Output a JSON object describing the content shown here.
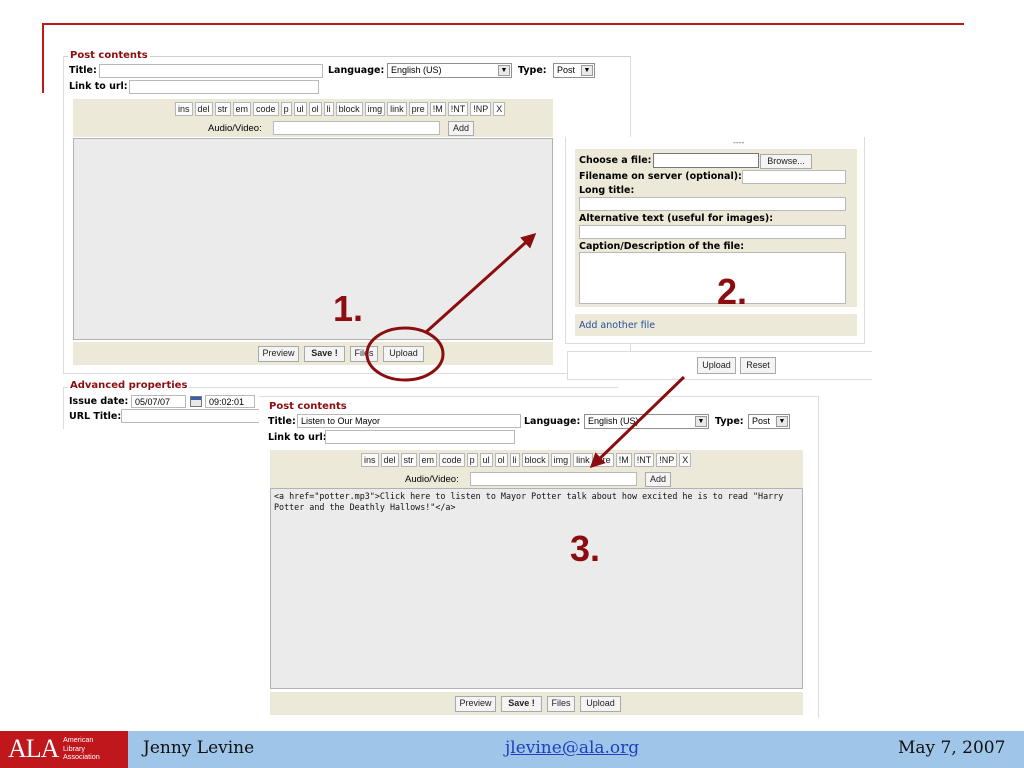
{
  "slide": {
    "accent_color": "#c0171d",
    "annotation_color": "#8b0d10",
    "step1": "1.",
    "step2": "2.",
    "step3": "3."
  },
  "panel1": {
    "legend": "Post contents",
    "title_label": "Title:",
    "title_value": "",
    "language_label": "Language:",
    "language_value": "English (US)",
    "type_label": "Type:",
    "type_value": "Post",
    "link_label": "Link to url:",
    "link_value": "",
    "toolbar": [
      "ins",
      "del",
      "str",
      "em",
      "code",
      "p",
      "ul",
      "ol",
      "li",
      "block",
      "img",
      "link",
      "pre",
      "!M",
      "!NT",
      "!NP",
      "X"
    ],
    "audio_label": "Audio/Video:",
    "audio_value": "",
    "add_label": "Add",
    "body_text": "",
    "buttons": {
      "preview": "Preview",
      "save": "Save !",
      "files": "Files",
      "upload": "Upload"
    }
  },
  "advanced": {
    "legend": "Advanced properties",
    "issue_label": "Issue date:",
    "issue_value": "05/07/07",
    "time_value": "09:02:01",
    "url_title_label": "URL Title:",
    "url_title_value": ""
  },
  "upload_panel": {
    "dashes": "----",
    "choose_label": "Choose a file:",
    "choose_value": "",
    "browse_label": "Browse...",
    "filename_label": "Filename on server (optional):",
    "filename_value": "",
    "long_title_label": "Long title:",
    "long_title_value": "",
    "alt_label": "Alternative text (useful for images):",
    "alt_value": "",
    "caption_label": "Caption/Description of the file:",
    "caption_value": "",
    "add_another": "Add another file",
    "upload_button": "Upload",
    "reset_button": "Reset"
  },
  "panel2": {
    "legend": "Post contents",
    "title_label": "Title:",
    "title_value": "Listen to Our Mayor",
    "language_label": "Language:",
    "language_value": "English (US)",
    "type_label": "Type:",
    "type_value": "Post",
    "link_label": "Link to url:",
    "link_value": "",
    "toolbar": [
      "ins",
      "del",
      "str",
      "em",
      "code",
      "p",
      "ul",
      "ol",
      "li",
      "block",
      "img",
      "link",
      "pre",
      "!M",
      "!NT",
      "!NP",
      "X"
    ],
    "audio_label": "Audio/Video:",
    "audio_value": "",
    "add_label": "Add",
    "body_text": "<a href=\"potter.mp3\">Click here to listen to Mayor Potter talk about how excited he is to read \"Harry Potter and the Deathly Hallows!\"</a>",
    "buttons": {
      "preview": "Preview",
      "save": "Save !",
      "files": "Files",
      "upload": "Upload"
    }
  },
  "footer": {
    "logo_text": "ALA",
    "logo_sub": [
      "American",
      "Library",
      "Association"
    ],
    "name": "Jenny Levine",
    "email": "jlevine@ala.org",
    "date": "May 7, 2007"
  }
}
